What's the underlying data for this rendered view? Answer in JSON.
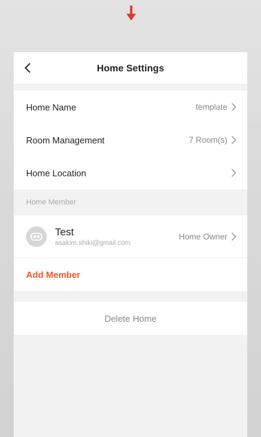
{
  "header": {
    "title": "Home Settings"
  },
  "settings": {
    "home_name_label": "Home Name",
    "home_name_value": "template",
    "room_management_label": "Room Management",
    "room_management_value": "7 Room(s)",
    "home_location_label": "Home Location",
    "home_location_value": ""
  },
  "members": {
    "section_title": "Home Member",
    "items": [
      {
        "name": "Test",
        "email": "asakim.shiki@gmail.com",
        "role": "Home Owner"
      }
    ],
    "add_label": "Add Member"
  },
  "actions": {
    "delete_label": "Delete Home"
  },
  "colors": {
    "accent": "#f2572b",
    "arrow": "#e33a2c",
    "background": "#f2f2f2"
  },
  "icons": {
    "back": "chevron-left-icon",
    "row": "chevron-right-icon",
    "avatar": "user-avatar-icon",
    "pointer": "arrow-down-icon"
  }
}
